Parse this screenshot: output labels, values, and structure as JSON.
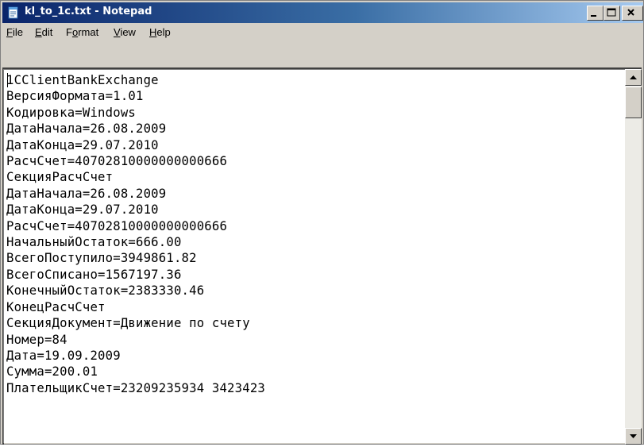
{
  "window": {
    "title": "kl_to_1c.txt - Notepad",
    "icon": "notepad-icon"
  },
  "menu": [
    {
      "pre": "",
      "u": "F",
      "post": "ile"
    },
    {
      "pre": "",
      "u": "E",
      "post": "dit"
    },
    {
      "pre": "F",
      "u": "o",
      "post": "rmat"
    },
    {
      "pre": "",
      "u": "V",
      "post": "iew"
    },
    {
      "pre": "",
      "u": "H",
      "post": "elp"
    }
  ],
  "document": {
    "lines": [
      "1CClientBankExchange",
      "ВерсияФормата=1.01",
      "Кодировка=Windows",
      "ДатаНачала=26.08.2009",
      "ДатаКонца=29.07.2010",
      "РасчСчет=40702810000000000666",
      "СекцияРасчСчет",
      "ДатаНачала=26.08.2009",
      "ДатаКонца=29.07.2010",
      "РасчСчет=40702810000000000666",
      "НачальныйОстаток=666.00",
      "ВсегоПоступило=3949861.82",
      "ВсегоСписано=1567197.36",
      "КонечныйОстаток=2383330.46",
      "КонецРасчСчет",
      "СекцияДокумент=Движение по счету",
      "Номер=84",
      "Дата=19.09.2009",
      "Сумма=200.01",
      "ПлательщикСчет=23209235934 3423423"
    ]
  },
  "colors": {
    "titlebar_start": "#0a246a",
    "titlebar_end": "#a6caf0",
    "chrome": "#d4d0c8"
  }
}
